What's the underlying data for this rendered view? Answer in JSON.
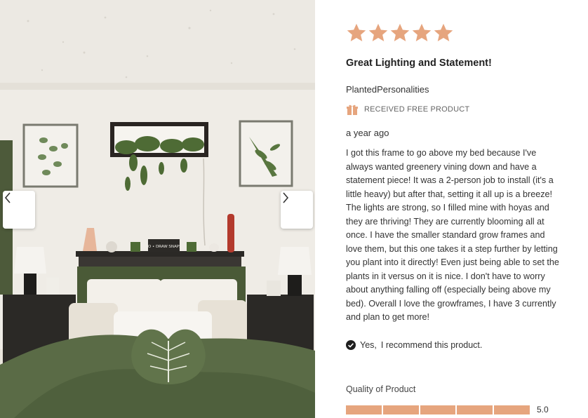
{
  "photo": {
    "prev_label": "Previous image",
    "next_label": "Next image",
    "sign_text": "SO • DRAW SNAPS"
  },
  "review": {
    "rating": 5,
    "rating_max": 5,
    "star_color": "#e6a57e",
    "title": "Great Lighting and Statement!",
    "author": "PlantedPersonalities",
    "badge": "RECEIVED FREE PRODUCT",
    "timestamp": "a year ago",
    "body": "I got this frame to go above my bed because I've always wanted greenery vining down and have a statement piece! It was a 2-person job to install (it's a little heavy) but after that, setting it all up is a breeze! The lights are strong, so I filled mine with hoyas and they are thriving! They are currently blooming all at once. I have the smaller standard grow frames and love them, but this one takes it a step further by letting you plant into it directly! Even just being able to set the plants in it versus on it is nice. I don't have to worry about anything falling off (especially being above my bed). Overall I love the growframes, I have 3 currently and plan to get more!",
    "recommend_yes": "Yes,",
    "recommend_text": "I recommend this product."
  },
  "quality": {
    "label": "Quality of Product",
    "score": 5.0,
    "score_text": "5.0",
    "max": 5,
    "bar_color": "#e6a57e"
  }
}
